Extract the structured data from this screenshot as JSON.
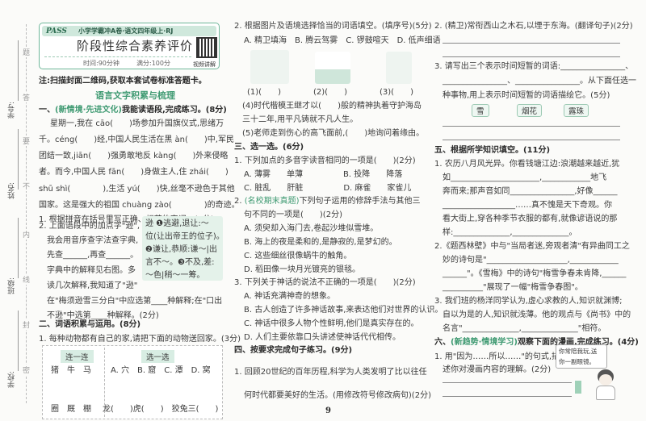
{
  "binding": {
    "fields": [
      "学号:",
      "姓名:",
      "班级:",
      "学校:"
    ],
    "seal": [
      "题",
      "答",
      "要",
      "不",
      "内",
      "线",
      "封",
      "密"
    ]
  },
  "header": {
    "logo": "PASS",
    "series": "小学学霸冲A卷·语文四年级上·RJ",
    "title": "阶段性综合素养评价",
    "time": "时间:90分钟",
    "score": "满分:100分",
    "qr_label": "视频讲解"
  },
  "note": "注:扫描封面二维码,获取本套试卷标准答题卡。",
  "section_title": "语言文字积累与梳理",
  "s1": {
    "num": "一、",
    "tag": "(新情境·先进文化)",
    "title": "我能读语段,完成练习。(8分)",
    "passage": [
      "星期一,我在 cāo(　　)场参加升国旗仪式,思绪万",
      "千。céng(　　)经,中国人民生活在黑 àn(　　)中,军民",
      "团结一致,jiān(　　)强勇敢地反 kàng(　　)外来侵略",
      "者。而今,中国人民 fān(　　)身做主人,住 zhái(　　)",
      "shū shì(　　　　),生活 yú(　　)快,丝毫不逊色于其他",
      "国家。这是强大的祖国 chuàng zào(　　　　)的奇迹。"
    ],
    "q1": "1. 根据拼音在括号里写正确、规范的字词。(6分)",
    "q2": [
      "2. 上面语段中的加点字\"逊\",",
      "我会用音序查字法查字典,",
      "先查______,再查______。",
      "字典中的解释见右图。多",
      "读几次解释,我知道了\"逊\"",
      "在\"梅须逊雪三分白\"中应选第____种解释;在\"口出",
      "不逊\"中选第____种解释。(2分)"
    ],
    "dict": [
      "逊 ❶逃避,退让:～",
      "位(让出帝王的位子)。",
      "❷谦让,恭顺:谦～|出",
      "言不～。❸不及,差:",
      "～色|稍～一筹。"
    ]
  },
  "s2": {
    "title": "二、词语积累与运用。(8分)",
    "q1": "1. 每种动物都有自己的家,请把下面的动物送回家。(3分)",
    "link_label": "连一连",
    "choose_label": "选一选",
    "animals": "猪　牛　马",
    "homes": "圈　厩　棚",
    "options": "A. 穴　B. 窟　C. 潭　D. 窝",
    "fill": "龙(　　)虎(　　)　狡兔三(　　)"
  },
  "c2": {
    "q2": "2. 根据图片及语境选择恰当的词语填空。(填序号)(5分)",
    "opts": "A. 精卫填海　B. 腾云驾雾　C. 锣鼓喧天　D. 低声细语",
    "pics": [
      "(1)(　　)",
      "(2)(　　)",
      "(3)(　　)"
    ],
    "q4a": "(4)时代楷模王继才以(　　)般的精神执着守护海岛",
    "q4b": "三十二年,用平凡铸就不凡人生。",
    "q5": "(5)老师走到伤心的高飞面前,(　　)地询问着缘由。"
  },
  "s3": {
    "title": "三、选一选。(6分)",
    "q1": "1. 下列加点的多音字读音相同的一项是(　　)(2分)",
    "q1a": "A. 薄雾　　单薄　　　　　B. 投降　　降落",
    "q1c": "C. 脏乱　　肝脏　　　　　D. 麻雀　　家雀儿",
    "q2tag": "(名校期末真题)",
    "q2": "下列句子运用的修辞手法与其他三",
    "q2b": "句不同的一项是(　　)(2分)",
    "q2opts": [
      "A. 须臾却入海门去,卷起沙堆似雪堆。",
      "B. 海上的夜是柔和的,是静寂的,是梦幻的。",
      "C. 这些细丝很像蜗牛的触角。",
      "D. 稻田像一块月光镀亮的银毯。"
    ],
    "q3": "3. 下列关于神话的说法不正确的一项是(　　)(2分)",
    "q3opts": [
      "A. 神话充满神奇的想象。",
      "B. 古人创造了许多神话故事,来表达他们对世界的认识。",
      "C. 神话中很多人物个性鲜明,他们是真实存在的。",
      "D. 人们主要依靠口头讲述使神话代代相传。"
    ]
  },
  "s4": {
    "title": "四、按要求完成句子练习。(9分)",
    "q1a": "1. 回顾20世纪的百年历程,科学为人类发明了比以往任",
    "q1b": "何时代都要美好的生活。(用修改符号修改病句)(2分)",
    "q2": "2. (精卫)常衔西山之木石,以堙于东海。(翻译句子)(2分)",
    "q3a": "3. 请写出三个表示时间短暂的词语:________________、",
    "q3b": "________________、________________。从下面任选一",
    "q3c": "种事物,用上表示时间短暂的词语描绘它。(5分)",
    "chips": [
      "雪",
      "烟花",
      "露珠"
    ]
  },
  "page_number": "9",
  "s5": {
    "title": "五、根据所学知识填空。(11分)",
    "lines": [
      "1. 农历八月风光异。你看钱塘江边:浪潮越来越近,犹",
      "如______________________,____________地飞",
      "奔而来;那声音如同________________,好像______",
      "__________________……真不愧是天下奇观。你",
      "看大街上,穿各种季节衣服的都有,就像谚语说的那",
      "样:______________,______________。",
      "2.《题西林壁》中与\"当局者迷,旁观者清\"有异曲同工之",
      "妙的诗句是\"____________________,____________",
      "______\"。《雪梅》中的诗句\"梅雪争春未肯降,______",
      "__________\"展现了一幅\"梅雪争春图\"。",
      "3. 我们班的杨洋同学认为,虚心求教的人,知识就渊博;",
      "自以为是的人,知识就浅薄。他的观点与《尚书》中的",
      "名言\"______________,______________\"相符。"
    ]
  },
  "s6": {
    "num": "六、",
    "tag": "(新趋势·情境学习)",
    "title": "观察下面的漫画,完成练习。(4分)",
    "q1a": "1. 用\"因为……所以……\"的句式,描",
    "q1b": "述你对漫画内容的理解。(2分)",
    "bubble": [
      "你常陪我玩,送",
      "你一副眼镜。"
    ]
  }
}
